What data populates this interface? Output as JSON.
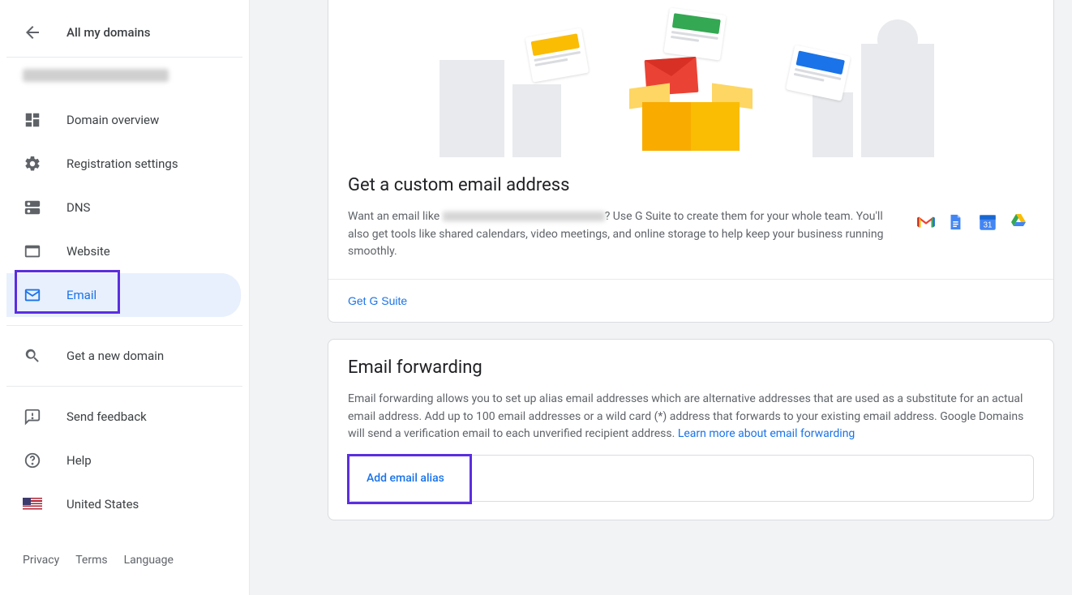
{
  "sidebar": {
    "back_label": "All my domains",
    "nav": [
      {
        "key": "overview",
        "label": "Domain overview"
      },
      {
        "key": "registration",
        "label": "Registration settings"
      },
      {
        "key": "dns",
        "label": "DNS"
      },
      {
        "key": "website",
        "label": "Website"
      },
      {
        "key": "email",
        "label": "Email"
      }
    ],
    "secondary": [
      {
        "key": "newdomain",
        "label": "Get a new domain"
      }
    ],
    "support": [
      {
        "key": "feedback",
        "label": "Send feedback"
      },
      {
        "key": "help",
        "label": "Help"
      },
      {
        "key": "locale",
        "label": "United States"
      }
    ],
    "footer": {
      "privacy": "Privacy",
      "terms": "Terms",
      "language": "Language"
    }
  },
  "cards": {
    "gsuite": {
      "title": "Get a custom email address",
      "text_prefix": "Want an email like ",
      "text_suffix": "? Use G Suite to create them for your whole team. You'll also get tools like shared calendars, video meetings, and online storage to help keep your business running smoothly.",
      "action": "Get G Suite"
    },
    "forwarding": {
      "title": "Email forwarding",
      "text": "Email forwarding allows you to set up alias email addresses which are alternative addresses that are used as a substitute for an actual email address. Add up to 100 email addresses or a wild card (*) address that forwards to your existing email address. Google Domains will send a verification email to each unverified recipient address. ",
      "learn_more": "Learn more about email forwarding",
      "add_alias": "Add email alias"
    }
  }
}
